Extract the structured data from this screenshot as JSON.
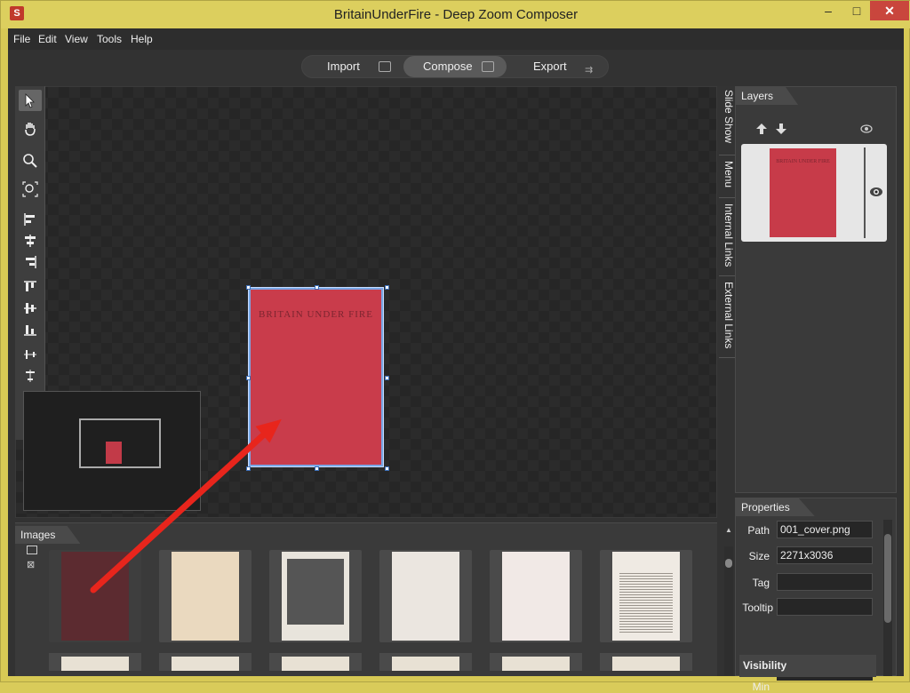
{
  "window": {
    "title": "BritainUnderFire - Deep Zoom Composer",
    "min": "–",
    "max": "□",
    "close": "✕"
  },
  "menu": [
    "File",
    "Edit",
    "View",
    "Tools",
    "Help"
  ],
  "modes": [
    {
      "label": "Import",
      "icon": "import-icon"
    },
    {
      "label": "Compose",
      "icon": "compose-icon",
      "active": true
    },
    {
      "label": "Export",
      "icon": "export-icon"
    }
  ],
  "canvas": {
    "cover_title": "BRITAIN UNDER FIRE"
  },
  "side_tabs": [
    "Slide Show",
    "Menu",
    "Internal Links",
    "External Links"
  ],
  "layers": {
    "tab": "Layers",
    "thumb_title": "BRITAIN UNDER FIRE"
  },
  "properties": {
    "tab": "Properties",
    "path_label": "Path",
    "path_value": "001_cover.png",
    "size_label": "Size",
    "size_value": "2271x3036",
    "tag_label": "Tag",
    "tag_value": "",
    "tooltip_label": "Tooltip",
    "tooltip_value": "",
    "visibility": "Visibility",
    "min_label": "Min",
    "min_value": ""
  },
  "images": {
    "tab": "Images"
  },
  "colors": {
    "accent_red": "#c93c4b",
    "selection": "#7aa7e6",
    "arrow": "#e8251c"
  }
}
